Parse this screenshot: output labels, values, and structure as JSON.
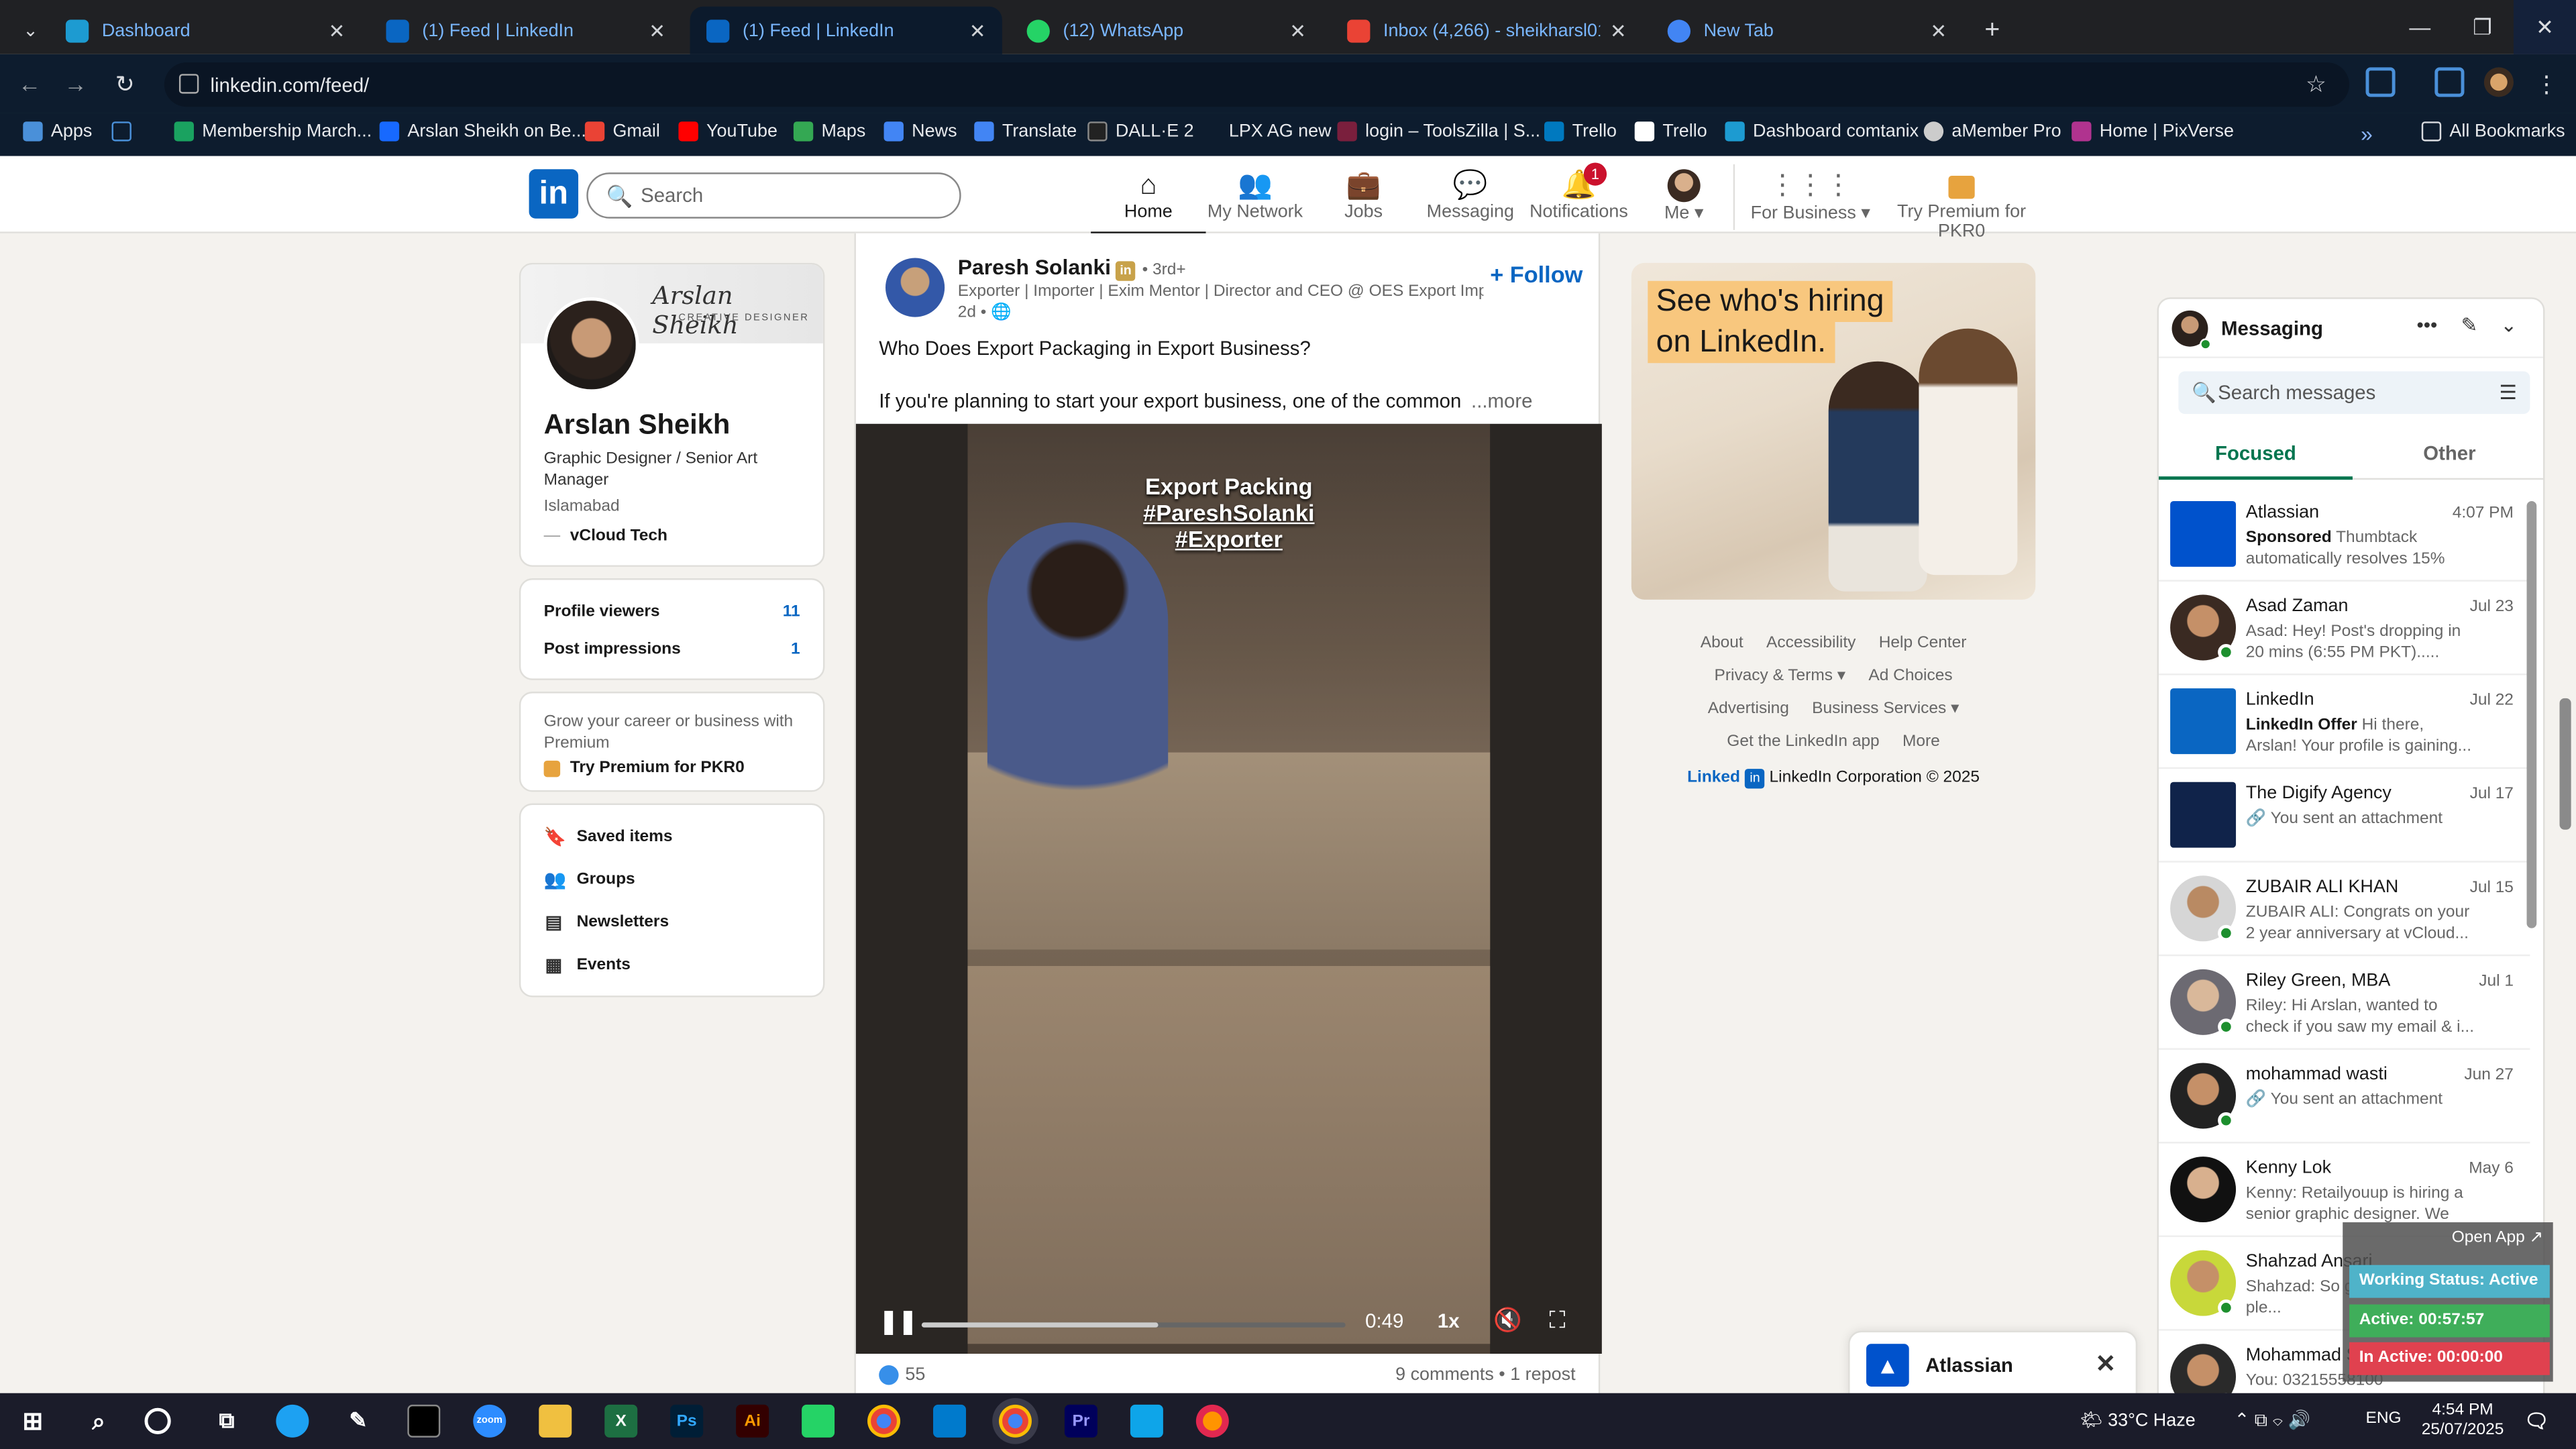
{
  "browser": {
    "tabs": [
      {
        "title": "Dashboard"
      },
      {
        "title": "(1) Feed | LinkedIn"
      },
      {
        "title": "(1) Feed | LinkedIn"
      },
      {
        "title": "(12) WhatsApp"
      },
      {
        "title": "Inbox (4,266) - sheikharsl01@g"
      },
      {
        "title": "New Tab"
      }
    ],
    "url": "linkedin.com/feed/",
    "bookmarks": [
      "Apps",
      "Membership March...",
      "Arslan Sheikh on Be...",
      "Gmail",
      "YouTube",
      "Maps",
      "News",
      "Translate",
      "DALL·E 2",
      "LPX AG new",
      "login – ToolsZilla | S...",
      "Trello",
      "Trello",
      "Dashboard comtanix",
      "aMember Pro",
      "Home | PixVerse",
      "All Bookmarks"
    ]
  },
  "nav": {
    "search_placeholder": "Search",
    "items": [
      {
        "label": "Home"
      },
      {
        "label": "My Network"
      },
      {
        "label": "Jobs"
      },
      {
        "label": "Messaging"
      },
      {
        "label": "Notifications",
        "badge": "1"
      },
      {
        "label": "Me"
      },
      {
        "label": "For Business"
      },
      {
        "label": "Try Premium for PKR0"
      }
    ]
  },
  "profile": {
    "banner_text": "Arslan Sheikh",
    "banner_sub": "CREATIVE DESIGNER",
    "name": "Arslan Sheikh",
    "headline": "Graphic Designer / Senior Art Manager",
    "location": "Islamabad",
    "company": "vCloud Tech"
  },
  "stats": [
    {
      "label": "Profile viewers",
      "value": "11"
    },
    {
      "label": "Post impressions",
      "value": "1"
    }
  ],
  "premium": {
    "text": "Grow your career or business with Premium",
    "link": "Try Premium for PKR0"
  },
  "shortcuts": [
    "Saved items",
    "Groups",
    "Newsletters",
    "Events"
  ],
  "post": {
    "author": "Paresh Solanki",
    "degree": "• 3rd+",
    "headline": "Exporter | Importer | Exim Mentor | Director and CEO @ OES Export Imp...",
    "time": "2d •",
    "follow": "+ Follow",
    "text1": "Who Does Export Packaging in Export Business?",
    "text2": "If you're planning to start your export business, one of the common",
    "more": "...more",
    "video_title": [
      "Export Packing",
      "#PareshSolanki",
      "#Exporter"
    ],
    "video_time": "0:49",
    "video_progress": 0.56,
    "playback_rate": "1x",
    "reactions": "55",
    "comments_reposts": "9 comments • 1 repost"
  },
  "ad": {
    "headline_1": "See who's hiring",
    "headline_2": "on LinkedIn."
  },
  "footer": {
    "links": [
      "About",
      "Accessibility",
      "Help Center",
      "Privacy & Terms ▾",
      "Ad Choices",
      "Advertising",
      "Business Services ▾",
      "Get the LinkedIn app",
      "More"
    ],
    "brand": "Linked",
    "copyright": "LinkedIn Corporation © 2025"
  },
  "messaging": {
    "title": "Messaging",
    "search_placeholder": "Search messages",
    "tabs": [
      "Focused",
      "Other"
    ],
    "conversations": [
      {
        "name": "Atlassian",
        "date": "4:07 PM",
        "preview_bold": "Sponsored",
        "preview": "Thumbtack automatically resolves 15% of..."
      },
      {
        "name": "Asad Zaman",
        "date": "Jul 23",
        "preview_bold": "",
        "preview": "Asad: Hey! Post's dropping in 20 mins (6:55 PM PKT)....."
      },
      {
        "name": "LinkedIn",
        "date": "Jul 22",
        "preview_bold": "LinkedIn Offer",
        "preview": "Hi there, Arslan! Your profile is gaining..."
      },
      {
        "name": "The Digify Agency",
        "date": "Jul 17",
        "preview_bold": "",
        "preview": "🔗 You sent an attachment"
      },
      {
        "name": "ZUBAIR ALI KHAN",
        "date": "Jul 15",
        "preview_bold": "",
        "preview": "ZUBAIR ALI: Congrats on your 2 year anniversary at vCloud..."
      },
      {
        "name": "Riley Green, MBA",
        "date": "Jul 1",
        "preview_bold": "",
        "preview": "Riley: Hi Arslan, wanted to check if you saw my email & i..."
      },
      {
        "name": "mohammad wasti",
        "date": "Jun 27",
        "preview_bold": "",
        "preview": "🔗 You sent an attachment"
      },
      {
        "name": "Kenny Lok",
        "date": "May 6",
        "preview_bold": "",
        "preview": "Kenny: Retailyouup is hiring a senior graphic designer. We hav..."
      },
      {
        "name": "Shahzad Ansari",
        "date": "",
        "preview_bold": "",
        "preview": "Shahzad: So g... here! It's a ple..."
      },
      {
        "name": "Mohammad S",
        "date": "",
        "preview_bold": "",
        "preview": "You: 03215558100"
      }
    ]
  },
  "toast": {
    "title": "Atlassian"
  },
  "work_status": {
    "open_app": "Open App ↗",
    "status": "Working Status: Active",
    "active": "Active: 00:57:57",
    "inactive": "In Active: 00:00:00"
  },
  "taskbar": {
    "weather": "33°C  Haze",
    "lang": "ENG",
    "time": "4:54 PM",
    "date": "25/07/2025"
  },
  "colors": {
    "brand": "#0a66c2",
    "focus_green": "#01754f",
    "online": "#1d8f2e"
  }
}
